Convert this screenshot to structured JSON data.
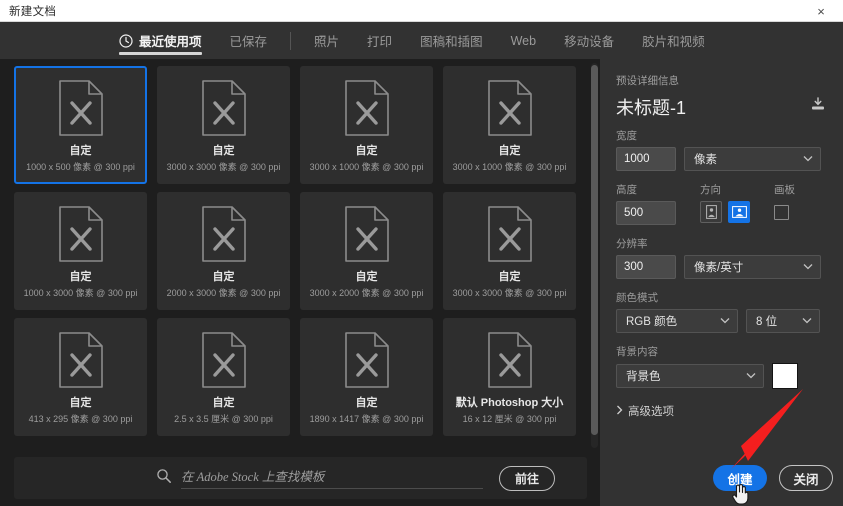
{
  "window": {
    "title": "新建文档",
    "close_icon": "close-icon",
    "close_label": "×"
  },
  "tabs": {
    "items": [
      {
        "label": "最近使用项",
        "icon": "clock-icon",
        "active": true
      },
      {
        "label": "已保存",
        "active": false
      },
      {
        "label": "照片",
        "active": false
      },
      {
        "label": "打印",
        "active": false
      },
      {
        "label": "图稿和插图",
        "active": false
      },
      {
        "label": "Web",
        "active": false
      },
      {
        "label": "移动设备",
        "active": false
      },
      {
        "label": "胶片和视频",
        "active": false
      }
    ]
  },
  "presets": {
    "cards": [
      {
        "title": "自定",
        "sub": "1000 x 500 像素 @ 300 ppi",
        "selected": true
      },
      {
        "title": "自定",
        "sub": "3000 x 3000 像素 @ 300 ppi",
        "selected": false
      },
      {
        "title": "自定",
        "sub": "3000 x 1000 像素 @ 300 ppi",
        "selected": false
      },
      {
        "title": "自定",
        "sub": "3000 x 1000 像素 @ 300 ppi",
        "selected": false
      },
      {
        "title": "自定",
        "sub": "1000 x 3000 像素 @ 300 ppi",
        "selected": false
      },
      {
        "title": "自定",
        "sub": "2000 x 3000 像素 @ 300 ppi",
        "selected": false
      },
      {
        "title": "自定",
        "sub": "3000 x 2000 像素 @ 300 ppi",
        "selected": false
      },
      {
        "title": "自定",
        "sub": "3000 x 3000 像素 @ 300 ppi",
        "selected": false
      },
      {
        "title": "自定",
        "sub": "413 x 295 像素 @ 300 ppi",
        "selected": false
      },
      {
        "title": "自定",
        "sub": "2.5 x 3.5 厘米 @ 300 ppi",
        "selected": false
      },
      {
        "title": "自定",
        "sub": "1890 x 1417 像素 @ 300 ppi",
        "selected": false
      },
      {
        "title": "默认 Photoshop 大小",
        "sub": "16 x 12 厘米 @ 300 ppi",
        "selected": false
      }
    ]
  },
  "stock": {
    "placeholder": "在 Adobe Stock 上查找模板",
    "value": "",
    "search_icon": "search-icon",
    "goto_label": "前往"
  },
  "details": {
    "heading": "预设详细信息",
    "doc_name": "未标题-1",
    "save_preset_icon": "save-preset-icon",
    "width_label": "宽度",
    "width_value": "1000",
    "width_unit": "像素",
    "height_label": "高度",
    "height_value": "500",
    "orientation_label": "方向",
    "orientation_portrait_icon": "portrait-icon",
    "orientation_landscape_icon": "landscape-icon",
    "orientation_selected": "landscape",
    "artboard_label": "画板",
    "artboard_checked": false,
    "resolution_label": "分辨率",
    "resolution_value": "300",
    "resolution_unit": "像素/英寸",
    "color_mode_label": "颜色模式",
    "color_mode_value": "RGB 颜色",
    "bit_depth_value": "8 位",
    "background_label": "背景内容",
    "background_value": "背景色",
    "background_swatch": "#ffffff",
    "advanced_label": "高级选项",
    "advanced_chevron_icon": "chevron-right-icon"
  },
  "footer": {
    "create_label": "创建",
    "close_label": "关闭"
  },
  "annotation": {
    "arrow_color": "#f41f1f",
    "arrow_icon": "red-arrow-annotation",
    "cursor_icon": "hand-cursor"
  },
  "colors": {
    "accent": "#1473e6",
    "panel_bg": "#323232",
    "grid_bg": "#1e1e1e",
    "card_bg": "#2e2e2e"
  }
}
